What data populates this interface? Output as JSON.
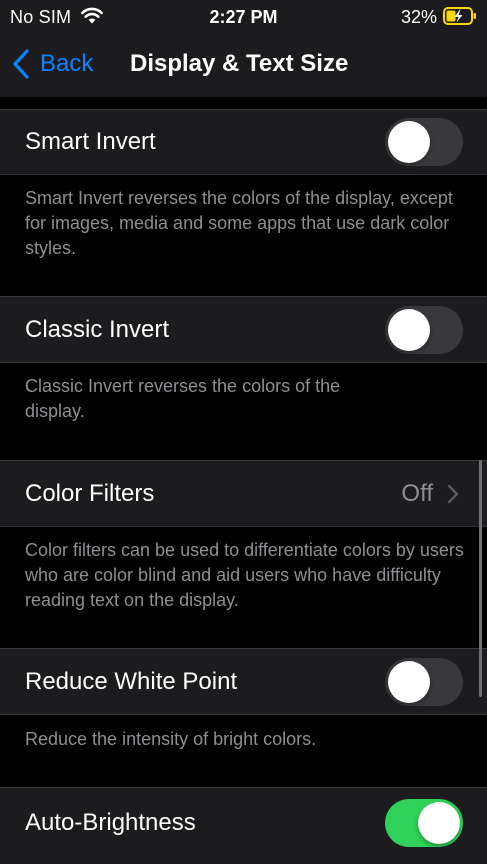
{
  "status_bar": {
    "carrier": "No SIM",
    "time": "2:27 PM",
    "battery": "32%"
  },
  "nav": {
    "back_label": "Back",
    "title": "Display & Text Size"
  },
  "rows": {
    "smart_invert": {
      "label": "Smart Invert",
      "toggle_on": false,
      "footer": "Smart Invert reverses the colors of the display, except for images, media and some apps that use dark color styles."
    },
    "classic_invert": {
      "label": "Classic Invert",
      "toggle_on": false,
      "footer": "Classic Invert reverses the colors of the display."
    },
    "color_filters": {
      "label": "Color Filters",
      "value": "Off",
      "footer": "Color filters can be used to differentiate colors by users who are color blind and aid users who have difficulty reading text on the display."
    },
    "reduce_white_point": {
      "label": "Reduce White Point",
      "toggle_on": false,
      "footer": "Reduce the intensity of bright colors."
    },
    "auto_brightness": {
      "label": "Auto-Brightness",
      "toggle_on": true
    }
  },
  "colors": {
    "accent": "#0a84ff",
    "toggle_on": "#30d158",
    "toggle_off": "#39393d",
    "cell_background": "#1c1c1e",
    "secondary_text": "#8e8e93",
    "battery_charging": "#ffd60a"
  },
  "icons": {
    "wifi": "wifi-icon",
    "battery": "battery-charging-icon",
    "back": "chevron-left-icon",
    "disclosure": "chevron-right-icon"
  }
}
